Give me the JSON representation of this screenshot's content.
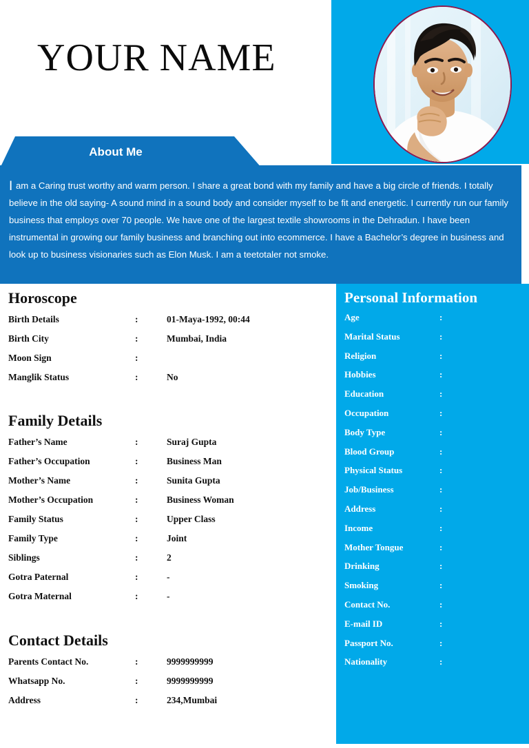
{
  "header": {
    "name": "YOUR NAME",
    "photo_alt": "portrait-photo"
  },
  "about": {
    "banner_label": "About Me",
    "dropcap": "I",
    "text": " am a Caring trust worthy and warm person. I share a great bond with my family and have a big circle of friends. I totally believe in the old saying- A sound mind in a sound body and consider myself to be fit and energetic. I currently run our family business that employs over 70 people. We have one of the largest textile showrooms in the Dehradun. I have been instrumental in growing our family business and branching out into ecommerce. I have a Bachelor’s degree in business and look up to business visionaries such as Elon Musk. I am a teetotaler not smoke."
  },
  "colors": {
    "light_blue": "#01a9e9",
    "dark_blue": "#1073bd",
    "photo_border": "#8e1a4e",
    "text_dark": "#111111",
    "white": "#ffffff"
  },
  "separator": ":",
  "horoscope": {
    "title": "Horoscope",
    "rows": [
      {
        "label": "Birth Details",
        "value": "01-Maya-1992, 00:44"
      },
      {
        "label": "Birth City",
        "value": "Mumbai, India"
      },
      {
        "label": "Moon Sign",
        "value": ""
      },
      {
        "label": "Manglik Status",
        "value": "No"
      }
    ]
  },
  "family": {
    "title": "Family Details",
    "rows": [
      {
        "label": "Father’s Name",
        "value": "Suraj Gupta"
      },
      {
        "label": "Father’s Occupation",
        "value": "Business Man"
      },
      {
        "label": "Mother’s Name",
        "value": "Sunita Gupta"
      },
      {
        "label": "Mother’s Occupation",
        "value": "Business Woman"
      },
      {
        "label": "Family Status",
        "value": "Upper Class"
      },
      {
        "label": "Family Type",
        "value": "Joint"
      },
      {
        "label": "Siblings",
        "value": "2"
      },
      {
        "label": "Gotra Paternal",
        "value": "-"
      },
      {
        "label": "Gotra Maternal",
        "value": "-"
      }
    ]
  },
  "contact": {
    "title": "Contact Details",
    "rows": [
      {
        "label": "Parents Contact No.",
        "value": "9999999999"
      },
      {
        "label": "Whatsapp No.",
        "value": "9999999999"
      },
      {
        "label": "Address",
        "value": "234,Mumbai"
      }
    ]
  },
  "personal": {
    "title": "Personal Information",
    "rows": [
      {
        "label": "Age",
        "value": ""
      },
      {
        "label": "Marital Status",
        "value": ""
      },
      {
        "label": "Religion",
        "value": ""
      },
      {
        "label": "Hobbies",
        "value": ""
      },
      {
        "label": "Education",
        "value": ""
      },
      {
        "label": "Occupation",
        "value": ""
      },
      {
        "label": "Body Type",
        "value": ""
      },
      {
        "label": "Blood Group",
        "value": ""
      },
      {
        "label": "Physical Status",
        "value": ""
      },
      {
        "label": "Job/Business",
        "value": ""
      },
      {
        "label": "Address",
        "value": ""
      },
      {
        "label": "Income",
        "value": ""
      },
      {
        "label": "Mother Tongue",
        "value": ""
      },
      {
        "label": "Drinking",
        "value": ""
      },
      {
        "label": "Smoking",
        "value": ""
      },
      {
        "label": "Contact No.",
        "value": ""
      },
      {
        "label": "E-mail ID",
        "value": ""
      },
      {
        "label": "Passport No.",
        "value": ""
      },
      {
        "label": "Nationality",
        "value": ""
      }
    ]
  }
}
